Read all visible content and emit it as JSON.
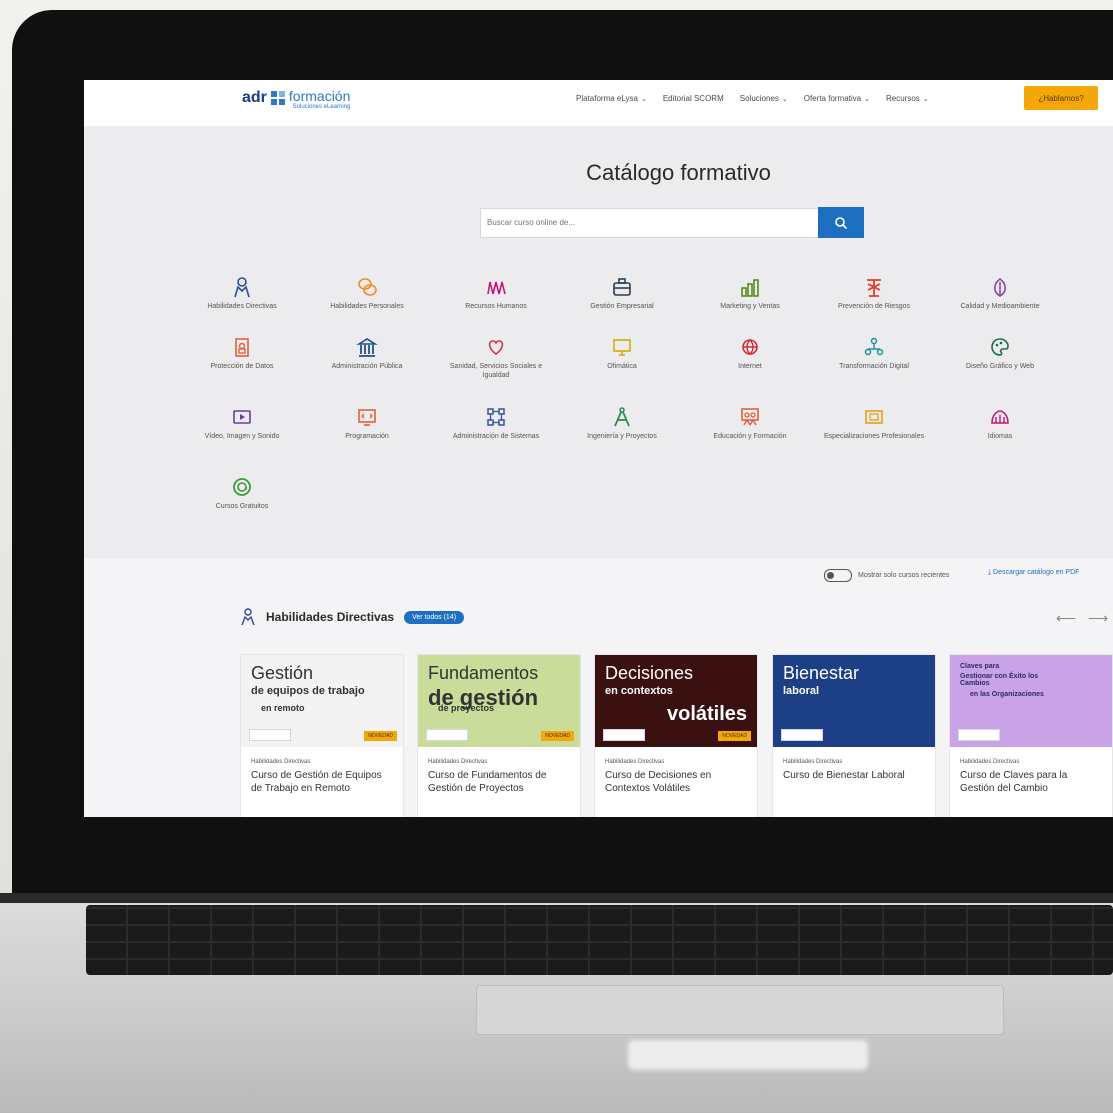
{
  "header": {
    "logo_adr": "adr",
    "logo_formacion": "formación",
    "logo_sub": "Soluciones eLearning",
    "nav": [
      {
        "label": "Plataforma eLysa",
        "has_chevron": true
      },
      {
        "label": "Editorial SCORM",
        "has_chevron": false
      },
      {
        "label": "Soluciones",
        "has_chevron": true
      },
      {
        "label": "Oferta formativa",
        "has_chevron": true
      },
      {
        "label": "Recursos",
        "has_chevron": true
      }
    ],
    "cta": "¿Hablamos?"
  },
  "hero": {
    "title": "Catálogo formativo",
    "search_placeholder": "Buscar curso online de..."
  },
  "categories": [
    {
      "label": "Habilidades Directivas",
      "icon": "leader-icon",
      "color": "#2e4b9c"
    },
    {
      "label": "Habilidades Personales",
      "icon": "chat-bubbles-icon",
      "color": "#f28c28"
    },
    {
      "label": "Recursos Humanos",
      "icon": "people-icon",
      "color": "#c2187a"
    },
    {
      "label": "Gestión Empresarial",
      "icon": "briefcase-icon",
      "color": "#2c3e50"
    },
    {
      "label": "Marketing y Ventas",
      "icon": "chart-icon",
      "color": "#5a8a1a"
    },
    {
      "label": "Prevención de Riesgos",
      "icon": "crane-icon",
      "color": "#e43b2c"
    },
    {
      "label": "Calidad y Medioambiente",
      "icon": "leaf-icon",
      "color": "#8e44ad"
    },
    {
      "label": "Protección de Datos",
      "icon": "document-lock-icon",
      "color": "#e2603a"
    },
    {
      "label": "Administración Pública",
      "icon": "building-icon",
      "color": "#1f4e8c"
    },
    {
      "label": "Sanidad, Servicios Sociales e Igualdad",
      "icon": "heart-hands-icon",
      "color": "#d63a3a"
    },
    {
      "label": "Ofimática",
      "icon": "monitor-icon",
      "color": "#d4a90f"
    },
    {
      "label": "Internet",
      "icon": "globe-icon",
      "color": "#d6283a"
    },
    {
      "label": "Transformación Digital",
      "icon": "network-icon",
      "color": "#1e8fa0"
    },
    {
      "label": "Diseño Gráfico y Web",
      "icon": "palette-icon",
      "color": "#1e6b4a"
    },
    {
      "label": "Vídeo, Imagen y Sonido",
      "icon": "video-icon",
      "color": "#6c3aa0"
    },
    {
      "label": "Programación",
      "icon": "code-screen-icon",
      "color": "#e2603a"
    },
    {
      "label": "Administración de Sistemas",
      "icon": "nodes-icon",
      "color": "#3a4fa0"
    },
    {
      "label": "Ingeniería y Proyectos",
      "icon": "compass-icon",
      "color": "#2a8a4a"
    },
    {
      "label": "Educación y Formación",
      "icon": "teacher-icon",
      "color": "#e2603a"
    },
    {
      "label": "Especializaciones Profesionales",
      "icon": "certificate-icon",
      "color": "#e0a020"
    },
    {
      "label": "Idiomas",
      "icon": "speech-icon",
      "color": "#c2187a"
    },
    {
      "label": "Cursos Gratuitos",
      "icon": "free-badge-icon",
      "color": "#3a9a3a"
    }
  ],
  "band": {
    "toggle_label": "Mostrar solo cursos recientes",
    "pdf_link": "Descargar catálogo en PDF",
    "section_title": "Habilidades Directivas",
    "section_badge": "Ver todos (14)"
  },
  "cards": [
    {
      "thumb_line1": "Gestión",
      "thumb_line2": "de equipos de trabajo",
      "thumb_line3": "en remoto",
      "thumb_bg": "#f3f3f3",
      "nov": "NOVEDAD",
      "category": "Habilidades Directivas",
      "name": "Curso de Gestión de Equipos de Trabajo en Remoto"
    },
    {
      "thumb_line1": "Fundamentos",
      "thumb_line2": "de gestión",
      "thumb_line3": "de proyectos",
      "thumb_bg": "#c9dc9a",
      "nov": "NOVEDAD",
      "category": "Habilidades Directivas",
      "name": "Curso de Fundamentos de Gestión de Proyectos"
    },
    {
      "thumb_line1": "Decisiones",
      "thumb_line2": "en contextos",
      "thumb_line3": "volátiles",
      "thumb_bg": "#3b1010",
      "nov": "NOVEDAD",
      "category": "Habilidades Directivas",
      "name": "Curso de Decisiones en Contextos Volátiles"
    },
    {
      "thumb_line1": "Bienestar",
      "thumb_line2": "laboral",
      "thumb_line3": "",
      "thumb_bg": "#1c3f86",
      "nov": "",
      "category": "Habilidades Directivas",
      "name": "Curso de Bienestar Laboral"
    },
    {
      "thumb_line1": "Claves para",
      "thumb_line2": "Gestionar con Éxito los Cambios",
      "thumb_line3": "en las Organizaciones",
      "thumb_bg": "#c9a3e6",
      "nov": "",
      "category": "Habilidades Directivas",
      "name": "Curso de Claves para la Gestión del Cambio"
    }
  ]
}
